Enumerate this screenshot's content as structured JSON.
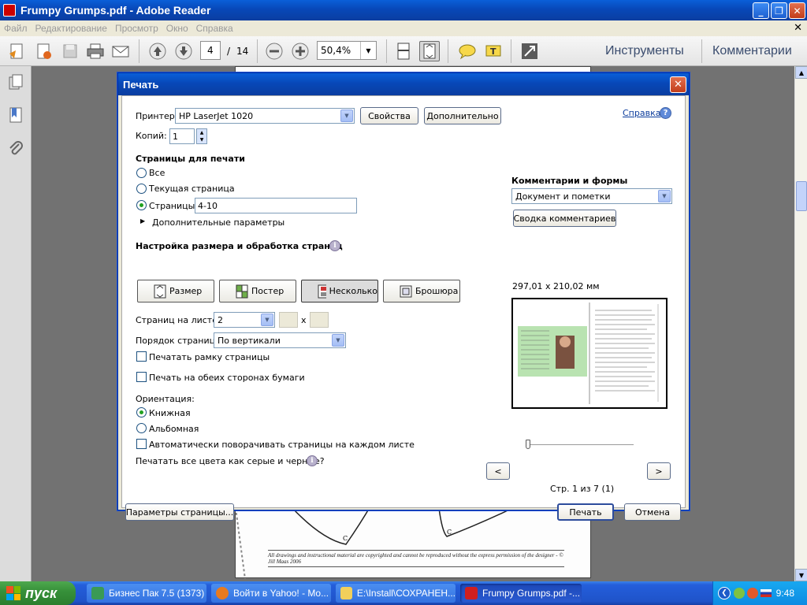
{
  "window": {
    "title": "Frumpy Grumps.pdf - Adobe Reader"
  },
  "menu": [
    "Файл",
    "Редактирование",
    "Просмотр",
    "Окно",
    "Справка"
  ],
  "toolbar": {
    "current_page": "4",
    "page_separator": "/",
    "total_pages": "14",
    "zoom": "50,4%",
    "tools_label": "Инструменты",
    "comments_label": "Комментарии"
  },
  "document": {
    "credit": "All drawings and instructional material are copyrighted and cannot be reproduced without the express permission of the designer - © Jill Maas 2006",
    "marks": [
      "C",
      "C"
    ]
  },
  "dialog": {
    "title": "Печать",
    "printer_label": "Принтер:",
    "printer_value": "HP LaserJet 1020",
    "properties_button": "Свойства",
    "advanced_button": "Дополнительно",
    "help_link": "Справка",
    "copies_label": "Копий:",
    "copies_value": "1",
    "pages_section": "Страницы для печати",
    "radio_all": "Все",
    "radio_current": "Текущая страница",
    "radio_pages": "Страницы",
    "pages_value": "4-10",
    "more_options": "Дополнительные параметры",
    "sizing_section": "Настройка размера и обработка страниц",
    "mode_size": "Размер",
    "mode_poster": "Постер",
    "mode_multiple": "Несколько",
    "mode_booklet": "Брошюра",
    "pages_per_sheet_label": "Страниц на листе:",
    "pages_per_sheet_value": "2",
    "grid_x": "x",
    "page_order_label": "Порядок страниц:",
    "page_order_value": "По вертикали",
    "print_border": "Печатать рамку страницы",
    "duplex": "Печать на обеих сторонах бумаги",
    "orientation_label": "Ориентация:",
    "portrait": "Книжная",
    "landscape": "Альбомная",
    "auto_rotate": "Автоматически поворачивать страницы на каждом листе",
    "grayscale_question": "Печатать все цвета как серые и черные?",
    "comments_forms_section": "Комментарии и формы",
    "comments_forms_value": "Документ и пометки",
    "summarize_button": "Сводка комментариев",
    "preview_size": "297,01 x 210,02 мм",
    "prev_button": "<",
    "next_button": ">",
    "page_indicator": "Стр. 1 из 7 (1)",
    "page_setup_button": "Параметры страницы...",
    "print_button": "Печать",
    "cancel_button": "Отмена"
  },
  "taskbar": {
    "start_label": "пуск",
    "tasks": [
      "Бизнес Пак 7.5 (1373)",
      "Войти в Yahoo! - Mo...",
      "E:\\Install\\СОХРАНЕН...",
      "Frumpy Grumps.pdf -..."
    ],
    "clock": "9:48"
  },
  "colors": {
    "titlebar": "#0848b8",
    "dialog_bg": "#ece9d8",
    "radio_selected": "#21a121",
    "taskbar": "#245edb",
    "start": "#37913a"
  }
}
